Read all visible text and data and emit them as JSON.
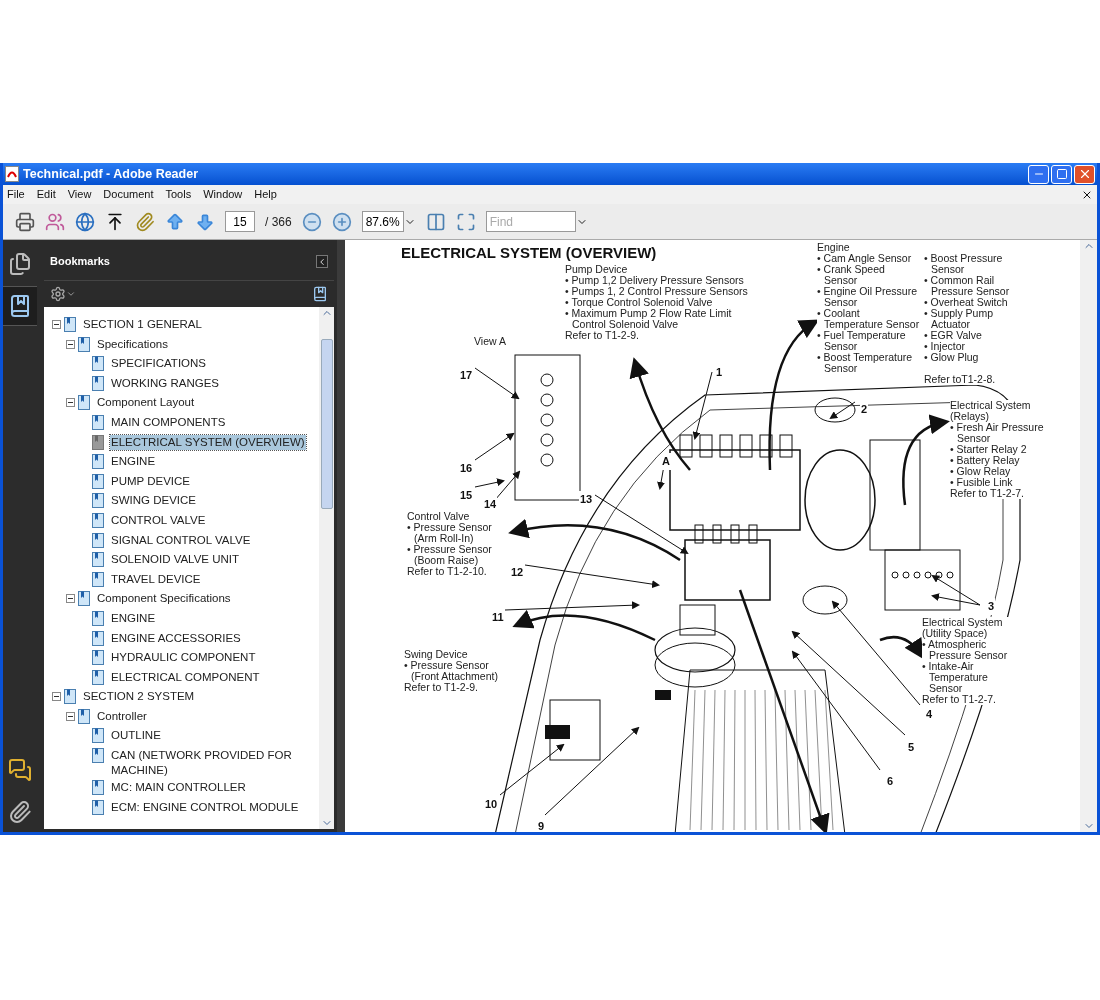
{
  "window": {
    "title": "Technical.pdf - Adobe Reader"
  },
  "menu": [
    "File",
    "Edit",
    "View",
    "Document",
    "Tools",
    "Window",
    "Help"
  ],
  "toolbar": {
    "page": "15",
    "page_total": "/ 366",
    "zoom": "87.6%",
    "find_placeholder": "Find"
  },
  "nav_tabs": [
    {
      "kind": "pages",
      "selected": false
    },
    {
      "kind": "bookmarks",
      "selected": true
    },
    {
      "kind": "comments",
      "selected": false
    },
    {
      "kind": "attachments",
      "selected": false
    }
  ],
  "bookmarks": {
    "title": "Bookmarks",
    "items": [
      {
        "label": "SECTION 1 GENERAL",
        "selected": false,
        "expanded": true,
        "children": [
          {
            "label": "Specifications",
            "selected": false,
            "expanded": true,
            "children": [
              {
                "label": "SPECIFICATIONS",
                "selected": false
              },
              {
                "label": "WORKING RANGES",
                "selected": false
              }
            ]
          },
          {
            "label": "Component Layout",
            "selected": false,
            "expanded": true,
            "children": [
              {
                "label": "MAIN COMPONENTS",
                "selected": false
              },
              {
                "label": "ELECTRICAL SYSTEM (OVERVIEW)",
                "selected": true
              },
              {
                "label": "ENGINE",
                "selected": false
              },
              {
                "label": "PUMP DEVICE",
                "selected": false
              },
              {
                "label": "SWING DEVICE",
                "selected": false
              },
              {
                "label": "CONTROL VALVE",
                "selected": false
              },
              {
                "label": "SIGNAL CONTROL VALVE",
                "selected": false
              },
              {
                "label": "SOLENOID VALVE UNIT",
                "selected": false
              },
              {
                "label": "TRAVEL DEVICE",
                "selected": false
              }
            ]
          },
          {
            "label": "Component Specifications",
            "selected": false,
            "expanded": true,
            "children": [
              {
                "label": "ENGINE",
                "selected": false
              },
              {
                "label": "ENGINE ACCESSORIES",
                "selected": false
              },
              {
                "label": "HYDRAULIC COMPONENT",
                "selected": false
              },
              {
                "label": "ELECTRICAL COMPONENT",
                "selected": false
              }
            ]
          }
        ]
      },
      {
        "label": "SECTION 2 SYSTEM",
        "selected": false,
        "expanded": true,
        "children": [
          {
            "label": "Controller",
            "selected": false,
            "expanded": true,
            "children": [
              {
                "label": "OUTLINE",
                "selected": false
              },
              {
                "label": "CAN (NETWORK PROVIDED FOR MACHINE)",
                "selected": false
              },
              {
                "label": "MC: MAIN CONTROLLER",
                "selected": false
              },
              {
                "label": "ECM: ENGINE CONTROL MODULE",
                "selected": false
              }
            ]
          }
        ]
      }
    ]
  },
  "page": {
    "heading": "ELECTRICAL SYSTEM (OVERVIEW)",
    "callouts": [
      {
        "kind": "list",
        "title": "Pump Device",
        "bullets": [
          "• Pump 1,2 Delivery Pressure Sensors",
          "• Pumps 1, 2 Control Pressure Sensors",
          "• Torque Control Solenoid Valve",
          "• Maximum Pump 2 Flow Rate Limit Control Solenoid Valve"
        ],
        "ref": "Refer to T1-2-9."
      },
      {
        "kind": "two_column",
        "title": "Engine",
        "bullets": [
          "• Cam Angle Sensor",
          "• Crank Speed Sensor",
          "• Engine Oil Pressure Sensor",
          "• Coolant Temperature Sensor",
          "• Fuel Temperature Sensor",
          "• Boost Temperature Sensor"
        ],
        "bullets_right": [
          "• Boost Pressure Sensor",
          "• Common Rail Pressure Sensor",
          "• Overheat Switch",
          "• Supply Pump Actuator",
          "• EGR Valve",
          "• Injector",
          "• Glow Plug"
        ],
        "ref": "Refer toT1-2-8."
      },
      {
        "kind": "list",
        "title": "Electrical System (Relays)",
        "bullets": [
          "• Fresh Air Pressure Sensor",
          "• Starter Relay 2",
          "• Battery Relay",
          "• Glow Relay",
          "• Fusible Link"
        ],
        "ref": "Refer to T1-2-7."
      },
      {
        "kind": "list",
        "title": "Control Valve",
        "bullets": [
          "• Pressure Sensor (Arm Roll-In)",
          "• Pressure Sensor (Boom Raise)"
        ],
        "ref": "Refer to T1-2-10."
      },
      {
        "kind": "list",
        "title": "Swing Device",
        "bullets": [
          "• Pressure Sensor (Front Attachment)"
        ],
        "ref": "Refer to T1-2-9."
      },
      {
        "kind": "list",
        "title": "Electrical System (Utility Space)",
        "bullets": [
          "• Atmospheric Pressure Sensor",
          "• Intake-Air Temperature Sensor"
        ],
        "ref": "Refer to T1-2-7."
      }
    ],
    "view_label": "View A",
    "callout_numbers": [
      "1",
      "17",
      "2",
      "A",
      "16",
      "15",
      "13",
      "14",
      "12",
      "3",
      "11",
      "4",
      "5",
      "6",
      "10",
      "9"
    ]
  }
}
